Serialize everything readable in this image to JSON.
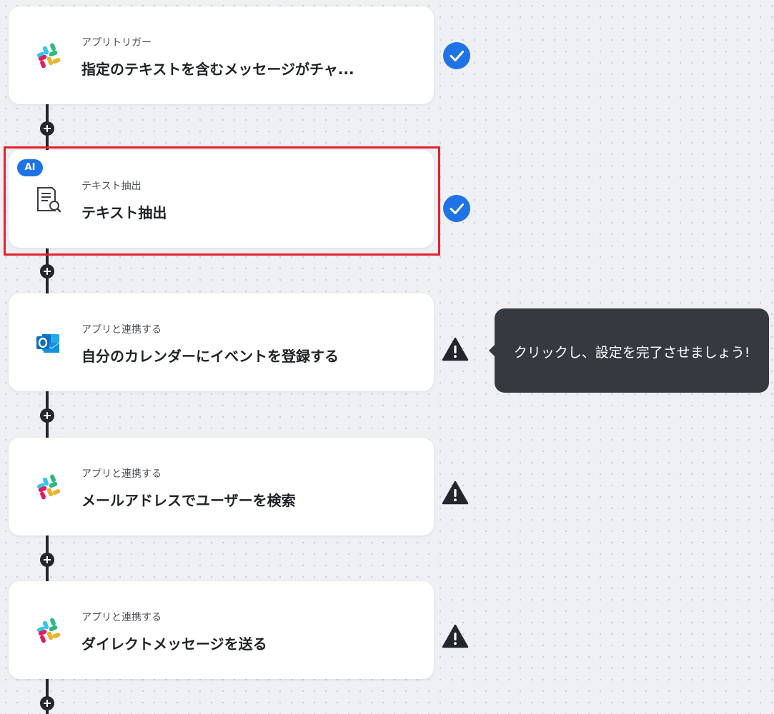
{
  "steps": [
    {
      "sub_label": "アプリトリガー",
      "title": "指定のテキストを含むメッセージがチャ...",
      "icon": "slack-icon",
      "status": "complete-check-icon"
    },
    {
      "badge": "AI",
      "sub_label": "テキスト抽出",
      "title": "テキスト抽出",
      "icon": "text-extract-icon",
      "status": "complete-check-icon"
    },
    {
      "sub_label": "アプリと連携する",
      "title": "自分のカレンダーにイベントを登録する",
      "icon": "outlook-icon",
      "status": "warning-icon"
    },
    {
      "sub_label": "アプリと連携する",
      "title": "メールアドレスでユーザーを検索",
      "icon": "slack-icon",
      "status": "warning-icon"
    },
    {
      "sub_label": "アプリと連携する",
      "title": "ダイレクトメッセージを送る",
      "icon": "slack-icon",
      "status": "warning-icon"
    }
  ],
  "tooltip": {
    "text": "クリックし、設定を完了させましょう!"
  },
  "colors": {
    "accent": "#1f73e6",
    "highlight": "#e5202a",
    "tooltip_bg": "#353940",
    "connector": "#23262c",
    "slack": [
      "#e01e5a",
      "#36c5f0",
      "#2eb67d",
      "#ecb22e"
    ],
    "outlook": "#0f6cbd"
  }
}
